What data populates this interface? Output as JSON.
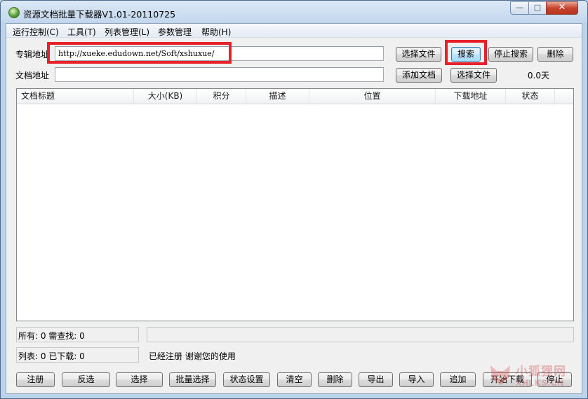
{
  "window": {
    "title": "资源文档批量下载器V1.01-20110725",
    "controls": {
      "minimize": "—",
      "maximize": "□",
      "close": "✕"
    }
  },
  "menu": [
    "运行控制(C)",
    "工具(T)",
    "列表管理(L)",
    "参数管理",
    "帮助(H)"
  ],
  "album": {
    "label": "专辑地址",
    "url": "http://xueke.edudown.net/Soft/xshuxue/",
    "select_file": "选择文件",
    "search": "搜索",
    "stop_search": "停止搜索",
    "delete": "删除"
  },
  "doc": {
    "label": "文档地址",
    "value": "",
    "add_doc": "添加文档",
    "select_file": "选择文件",
    "days": "0.0天"
  },
  "table": {
    "columns": [
      "文档标题",
      "大小(KB)",
      "积分",
      "描述",
      "位置",
      "下载地址",
      "状态"
    ],
    "rows": []
  },
  "status": {
    "total": "所有: 0 需查找: 0",
    "list": "列表: 0 已下载: 0",
    "progress_text": "",
    "message": "已经注册 谢谢您的使用"
  },
  "buttons": [
    "注册",
    "反选",
    "选择",
    "批量选择",
    "状态设置",
    "清空",
    "删除",
    "导出",
    "导入",
    "追加",
    "开始下载",
    "停止"
  ],
  "watermark": {
    "text": "小狐狸网",
    "sub": "XHLKS.CN"
  },
  "colors": {
    "highlight": "#e8202a",
    "titlebar": "#c4d8ee"
  }
}
